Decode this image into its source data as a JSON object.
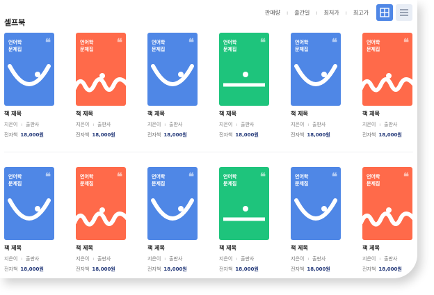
{
  "header": {
    "title": "셀프북",
    "sort_options": [
      "판매량",
      "출간일",
      "최저가",
      "최고가"
    ]
  },
  "colors": {
    "blue": "#4f87e6",
    "orange": "#ff6a4a",
    "green": "#1ec47c"
  },
  "rows": [
    [
      {
        "cover_text": [
          "언어학",
          "문제집"
        ],
        "color": "blue",
        "art": "smile",
        "name": "책 제목",
        "author": "지은이",
        "publisher": "출판사",
        "format": "전자책",
        "price": "18,000원"
      },
      {
        "cover_text": [
          "언어학",
          "문제집"
        ],
        "color": "orange",
        "art": "wave",
        "name": "책 제목",
        "author": "지은이",
        "publisher": "출판사",
        "format": "전자책",
        "price": "18,000원"
      },
      {
        "cover_text": [
          "언어학",
          "문제집"
        ],
        "color": "blue",
        "art": "smile",
        "name": "책 제목",
        "author": "지은이",
        "publisher": "출판사",
        "format": "전자책",
        "price": "18,000원"
      },
      {
        "cover_text": [
          "언어학",
          "문제집"
        ],
        "color": "green",
        "art": "line",
        "name": "책 제목",
        "author": "지은이",
        "publisher": "출판사",
        "format": "전자책",
        "price": "18,000원"
      },
      {
        "cover_text": [
          "언어학",
          "문제집"
        ],
        "color": "blue",
        "art": "smile",
        "name": "책 제목",
        "author": "지은이",
        "publisher": "출판사",
        "format": "전자책",
        "price": "18,000원"
      },
      {
        "cover_text": [
          "언어학",
          "문제집"
        ],
        "color": "orange",
        "art": "wave",
        "name": "책 제목",
        "author": "지은이",
        "publisher": "출판사",
        "format": "전자책",
        "price": "18,000원"
      }
    ],
    [
      {
        "cover_text": [
          "언어학",
          "문제집"
        ],
        "color": "blue",
        "art": "smile",
        "name": "책 제목",
        "author": "지은이",
        "publisher": "출판사",
        "format": "전자책",
        "price": "18,000원"
      },
      {
        "cover_text": [
          "언어학",
          "문제집"
        ],
        "color": "orange",
        "art": "wave",
        "name": "책 제목",
        "author": "지은이",
        "publisher": "출판사",
        "format": "전자책",
        "price": "18,000원"
      },
      {
        "cover_text": [
          "언어학",
          "문제집"
        ],
        "color": "blue",
        "art": "smile",
        "name": "책 제목",
        "author": "지은이",
        "publisher": "출판사",
        "format": "전자책",
        "price": "18,000원"
      },
      {
        "cover_text": [
          "언어학",
          "문제집"
        ],
        "color": "green",
        "art": "line",
        "name": "책 제목",
        "author": "지은이",
        "publisher": "출판사",
        "format": "전자책",
        "price": "18,000원"
      },
      {
        "cover_text": [
          "언어학",
          "문제집"
        ],
        "color": "blue",
        "art": "smile",
        "name": "책 제목",
        "author": "지은이",
        "publisher": "출판사",
        "format": "전자책",
        "price": "18,000원"
      },
      {
        "cover_text": [
          "언어학",
          "문제집"
        ],
        "color": "orange",
        "art": "wave",
        "name": "책 제목",
        "author": "지은이",
        "publisher": "출판사",
        "format": "전자책",
        "price": "18,000원"
      }
    ]
  ]
}
